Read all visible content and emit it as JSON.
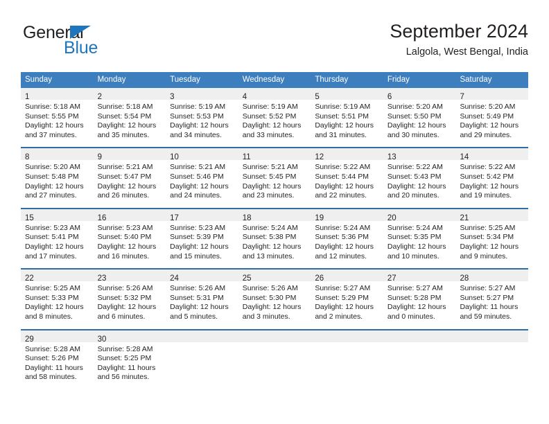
{
  "brand": {
    "name_part1": "General",
    "name_part2": "Blue",
    "triangle_color": "#1f76bc"
  },
  "header": {
    "title": "September 2024",
    "subtitle": "Lalgola, West Bengal, India"
  },
  "theme": {
    "header_blue": "#3d7ebf",
    "week_divider_blue": "#2e6da4",
    "day_band_gray": "#efefef",
    "text": "#231f20"
  },
  "weekdays": [
    "Sunday",
    "Monday",
    "Tuesday",
    "Wednesday",
    "Thursday",
    "Friday",
    "Saturday"
  ],
  "weeks": [
    [
      {
        "day": "1",
        "sunrise": "Sunrise: 5:18 AM",
        "sunset": "Sunset: 5:55 PM",
        "daylight1": "Daylight: 12 hours",
        "daylight2": "and 37 minutes."
      },
      {
        "day": "2",
        "sunrise": "Sunrise: 5:18 AM",
        "sunset": "Sunset: 5:54 PM",
        "daylight1": "Daylight: 12 hours",
        "daylight2": "and 35 minutes."
      },
      {
        "day": "3",
        "sunrise": "Sunrise: 5:19 AM",
        "sunset": "Sunset: 5:53 PM",
        "daylight1": "Daylight: 12 hours",
        "daylight2": "and 34 minutes."
      },
      {
        "day": "4",
        "sunrise": "Sunrise: 5:19 AM",
        "sunset": "Sunset: 5:52 PM",
        "daylight1": "Daylight: 12 hours",
        "daylight2": "and 33 minutes."
      },
      {
        "day": "5",
        "sunrise": "Sunrise: 5:19 AM",
        "sunset": "Sunset: 5:51 PM",
        "daylight1": "Daylight: 12 hours",
        "daylight2": "and 31 minutes."
      },
      {
        "day": "6",
        "sunrise": "Sunrise: 5:20 AM",
        "sunset": "Sunset: 5:50 PM",
        "daylight1": "Daylight: 12 hours",
        "daylight2": "and 30 minutes."
      },
      {
        "day": "7",
        "sunrise": "Sunrise: 5:20 AM",
        "sunset": "Sunset: 5:49 PM",
        "daylight1": "Daylight: 12 hours",
        "daylight2": "and 29 minutes."
      }
    ],
    [
      {
        "day": "8",
        "sunrise": "Sunrise: 5:20 AM",
        "sunset": "Sunset: 5:48 PM",
        "daylight1": "Daylight: 12 hours",
        "daylight2": "and 27 minutes."
      },
      {
        "day": "9",
        "sunrise": "Sunrise: 5:21 AM",
        "sunset": "Sunset: 5:47 PM",
        "daylight1": "Daylight: 12 hours",
        "daylight2": "and 26 minutes."
      },
      {
        "day": "10",
        "sunrise": "Sunrise: 5:21 AM",
        "sunset": "Sunset: 5:46 PM",
        "daylight1": "Daylight: 12 hours",
        "daylight2": "and 24 minutes."
      },
      {
        "day": "11",
        "sunrise": "Sunrise: 5:21 AM",
        "sunset": "Sunset: 5:45 PM",
        "daylight1": "Daylight: 12 hours",
        "daylight2": "and 23 minutes."
      },
      {
        "day": "12",
        "sunrise": "Sunrise: 5:22 AM",
        "sunset": "Sunset: 5:44 PM",
        "daylight1": "Daylight: 12 hours",
        "daylight2": "and 22 minutes."
      },
      {
        "day": "13",
        "sunrise": "Sunrise: 5:22 AM",
        "sunset": "Sunset: 5:43 PM",
        "daylight1": "Daylight: 12 hours",
        "daylight2": "and 20 minutes."
      },
      {
        "day": "14",
        "sunrise": "Sunrise: 5:22 AM",
        "sunset": "Sunset: 5:42 PM",
        "daylight1": "Daylight: 12 hours",
        "daylight2": "and 19 minutes."
      }
    ],
    [
      {
        "day": "15",
        "sunrise": "Sunrise: 5:23 AM",
        "sunset": "Sunset: 5:41 PM",
        "daylight1": "Daylight: 12 hours",
        "daylight2": "and 17 minutes."
      },
      {
        "day": "16",
        "sunrise": "Sunrise: 5:23 AM",
        "sunset": "Sunset: 5:40 PM",
        "daylight1": "Daylight: 12 hours",
        "daylight2": "and 16 minutes."
      },
      {
        "day": "17",
        "sunrise": "Sunrise: 5:23 AM",
        "sunset": "Sunset: 5:39 PM",
        "daylight1": "Daylight: 12 hours",
        "daylight2": "and 15 minutes."
      },
      {
        "day": "18",
        "sunrise": "Sunrise: 5:24 AM",
        "sunset": "Sunset: 5:38 PM",
        "daylight1": "Daylight: 12 hours",
        "daylight2": "and 13 minutes."
      },
      {
        "day": "19",
        "sunrise": "Sunrise: 5:24 AM",
        "sunset": "Sunset: 5:36 PM",
        "daylight1": "Daylight: 12 hours",
        "daylight2": "and 12 minutes."
      },
      {
        "day": "20",
        "sunrise": "Sunrise: 5:24 AM",
        "sunset": "Sunset: 5:35 PM",
        "daylight1": "Daylight: 12 hours",
        "daylight2": "and 10 minutes."
      },
      {
        "day": "21",
        "sunrise": "Sunrise: 5:25 AM",
        "sunset": "Sunset: 5:34 PM",
        "daylight1": "Daylight: 12 hours",
        "daylight2": "and 9 minutes."
      }
    ],
    [
      {
        "day": "22",
        "sunrise": "Sunrise: 5:25 AM",
        "sunset": "Sunset: 5:33 PM",
        "daylight1": "Daylight: 12 hours",
        "daylight2": "and 8 minutes."
      },
      {
        "day": "23",
        "sunrise": "Sunrise: 5:26 AM",
        "sunset": "Sunset: 5:32 PM",
        "daylight1": "Daylight: 12 hours",
        "daylight2": "and 6 minutes."
      },
      {
        "day": "24",
        "sunrise": "Sunrise: 5:26 AM",
        "sunset": "Sunset: 5:31 PM",
        "daylight1": "Daylight: 12 hours",
        "daylight2": "and 5 minutes."
      },
      {
        "day": "25",
        "sunrise": "Sunrise: 5:26 AM",
        "sunset": "Sunset: 5:30 PM",
        "daylight1": "Daylight: 12 hours",
        "daylight2": "and 3 minutes."
      },
      {
        "day": "26",
        "sunrise": "Sunrise: 5:27 AM",
        "sunset": "Sunset: 5:29 PM",
        "daylight1": "Daylight: 12 hours",
        "daylight2": "and 2 minutes."
      },
      {
        "day": "27",
        "sunrise": "Sunrise: 5:27 AM",
        "sunset": "Sunset: 5:28 PM",
        "daylight1": "Daylight: 12 hours",
        "daylight2": "and 0 minutes."
      },
      {
        "day": "28",
        "sunrise": "Sunrise: 5:27 AM",
        "sunset": "Sunset: 5:27 PM",
        "daylight1": "Daylight: 11 hours",
        "daylight2": "and 59 minutes."
      }
    ],
    [
      {
        "day": "29",
        "sunrise": "Sunrise: 5:28 AM",
        "sunset": "Sunset: 5:26 PM",
        "daylight1": "Daylight: 11 hours",
        "daylight2": "and 58 minutes."
      },
      {
        "day": "30",
        "sunrise": "Sunrise: 5:28 AM",
        "sunset": "Sunset: 5:25 PM",
        "daylight1": "Daylight: 11 hours",
        "daylight2": "and 56 minutes."
      },
      {
        "day": "",
        "sunrise": "",
        "sunset": "",
        "daylight1": "",
        "daylight2": ""
      },
      {
        "day": "",
        "sunrise": "",
        "sunset": "",
        "daylight1": "",
        "daylight2": ""
      },
      {
        "day": "",
        "sunrise": "",
        "sunset": "",
        "daylight1": "",
        "daylight2": ""
      },
      {
        "day": "",
        "sunrise": "",
        "sunset": "",
        "daylight1": "",
        "daylight2": ""
      },
      {
        "day": "",
        "sunrise": "",
        "sunset": "",
        "daylight1": "",
        "daylight2": ""
      }
    ]
  ]
}
